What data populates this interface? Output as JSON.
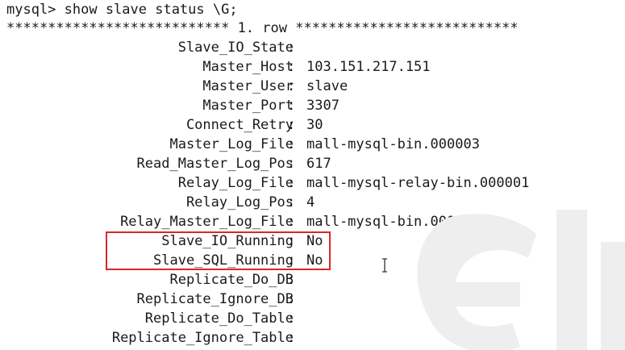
{
  "prompt_line": "mysql> show slave status \\G;",
  "separator_line": "*************************** 1. row ***************************",
  "fields": [
    {
      "key": "Slave_IO_State",
      "value": ""
    },
    {
      "key": "Master_Host",
      "value": "103.151.217.151"
    },
    {
      "key": "Master_User",
      "value": "slave"
    },
    {
      "key": "Master_Port",
      "value": "3307"
    },
    {
      "key": "Connect_Retry",
      "value": "30"
    },
    {
      "key": "Master_Log_File",
      "value": "mall-mysql-bin.000003"
    },
    {
      "key": "Read_Master_Log_Pos",
      "value": "617"
    },
    {
      "key": "Relay_Log_File",
      "value": "mall-mysql-relay-bin.000001"
    },
    {
      "key": "Relay_Log_Pos",
      "value": "4"
    },
    {
      "key": "Relay_Master_Log_File",
      "value": "mall-mysql-bin.000003"
    },
    {
      "key": "Slave_IO_Running",
      "value": "No"
    },
    {
      "key": "Slave_SQL_Running",
      "value": "No"
    },
    {
      "key": "Replicate_Do_DB",
      "value": ""
    },
    {
      "key": "Replicate_Ignore_DB",
      "value": ""
    },
    {
      "key": "Replicate_Do_Table",
      "value": ""
    },
    {
      "key": "Replicate_Ignore_Table",
      "value": ""
    }
  ],
  "colors": {
    "text": "#1a1a1a",
    "highlight_border": "#d9262b",
    "watermark": "#eeeeee"
  },
  "icons": {
    "cursor": "i-beam-cursor-icon"
  }
}
